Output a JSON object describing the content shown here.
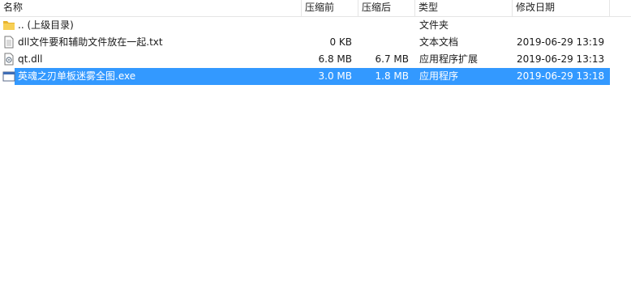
{
  "columns": {
    "name": "名称",
    "packed": "压缩前",
    "compressed": "压缩后",
    "type": "类型",
    "modified": "修改日期"
  },
  "rows": [
    {
      "icon": "folder-up-icon",
      "name": ".. (上级目录)",
      "packed": "",
      "compressed": "",
      "type": "文件夹",
      "modified": ""
    },
    {
      "icon": "text-file-icon",
      "name": "dll文件要和辅助文件放在一起.txt",
      "packed": "0 KB",
      "compressed": "",
      "type": "文本文档",
      "modified": "2019-06-29 13:19"
    },
    {
      "icon": "dll-file-icon",
      "name": "qt.dll",
      "packed": "6.8 MB",
      "compressed": "6.7 MB",
      "type": "应用程序扩展",
      "modified": "2019-06-29 13:13"
    },
    {
      "icon": "exe-file-icon",
      "name": "英魂之刃单板迷雾全图.exe",
      "packed": "3.0 MB",
      "compressed": "1.8 MB",
      "type": "应用程序",
      "modified": "2019-06-29 13:18",
      "selected": true
    }
  ],
  "colors": {
    "selection": "#3399ff",
    "folder": "#f0c040"
  }
}
